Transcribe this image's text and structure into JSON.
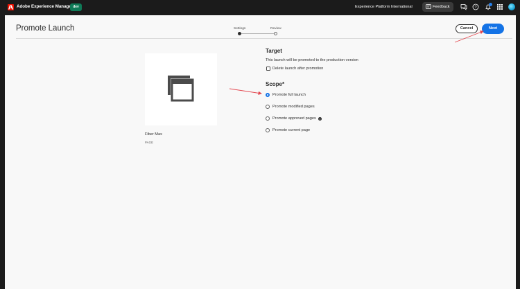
{
  "topbar": {
    "app_title": "Adobe Experience Manager",
    "env_badge": "dev",
    "org_name": "Experience Platform International",
    "feedback_label": "Feedback"
  },
  "page": {
    "title": "Promote Launch",
    "steps": [
      {
        "label": "Settings",
        "active": true
      },
      {
        "label": "Review",
        "active": false
      }
    ],
    "cancel_label": "Cancel",
    "next_label": "Next"
  },
  "item": {
    "name": "Fiber Max",
    "type": "PAGE"
  },
  "target": {
    "title": "Target",
    "description": "This launch will be promoted to the production version",
    "delete_label": "Delete launch after promotion",
    "delete_checked": false
  },
  "scope": {
    "title": "Scope*",
    "options": [
      {
        "label": "Promote full launch",
        "selected": true
      },
      {
        "label": "Promote modified pages",
        "selected": false
      },
      {
        "label": "Promote approved pages",
        "selected": false,
        "info": true
      },
      {
        "label": "Promote current page",
        "selected": false
      }
    ]
  },
  "colors": {
    "accent": "#1473e6",
    "annotation_arrow": "#e34850",
    "env_badge": "#0f7a57"
  }
}
